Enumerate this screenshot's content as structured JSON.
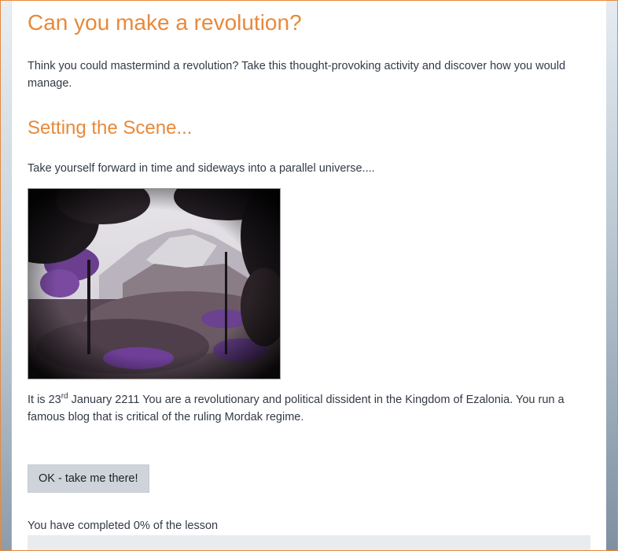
{
  "lesson": {
    "title": "Can you make a revolution?",
    "intro": "Think you could mastermind a revolution? Take this thought-provoking activity and discover how you would manage."
  },
  "scene": {
    "heading": "Setting the Scene...",
    "text": "Take yourself forward in time and sideways into a parallel universe....",
    "image_alt": "Forest landscape with purple flowers and mountain cliffs"
  },
  "story": {
    "prefix": "It is 23",
    "suffix_sup": "rd",
    "rest": " January 2211 You are a revolutionary and political dissident in  the Kingdom of Ezalonia. You run a famous blog that is critical of the ruling Mordak regime."
  },
  "actions": {
    "continue_label": "OK - take me there!"
  },
  "progress": {
    "label": "You have completed 0% of the lesson",
    "percent": 0
  },
  "colors": {
    "accent": "#e8893a",
    "text": "#333a45",
    "button_bg": "#ced4da"
  }
}
